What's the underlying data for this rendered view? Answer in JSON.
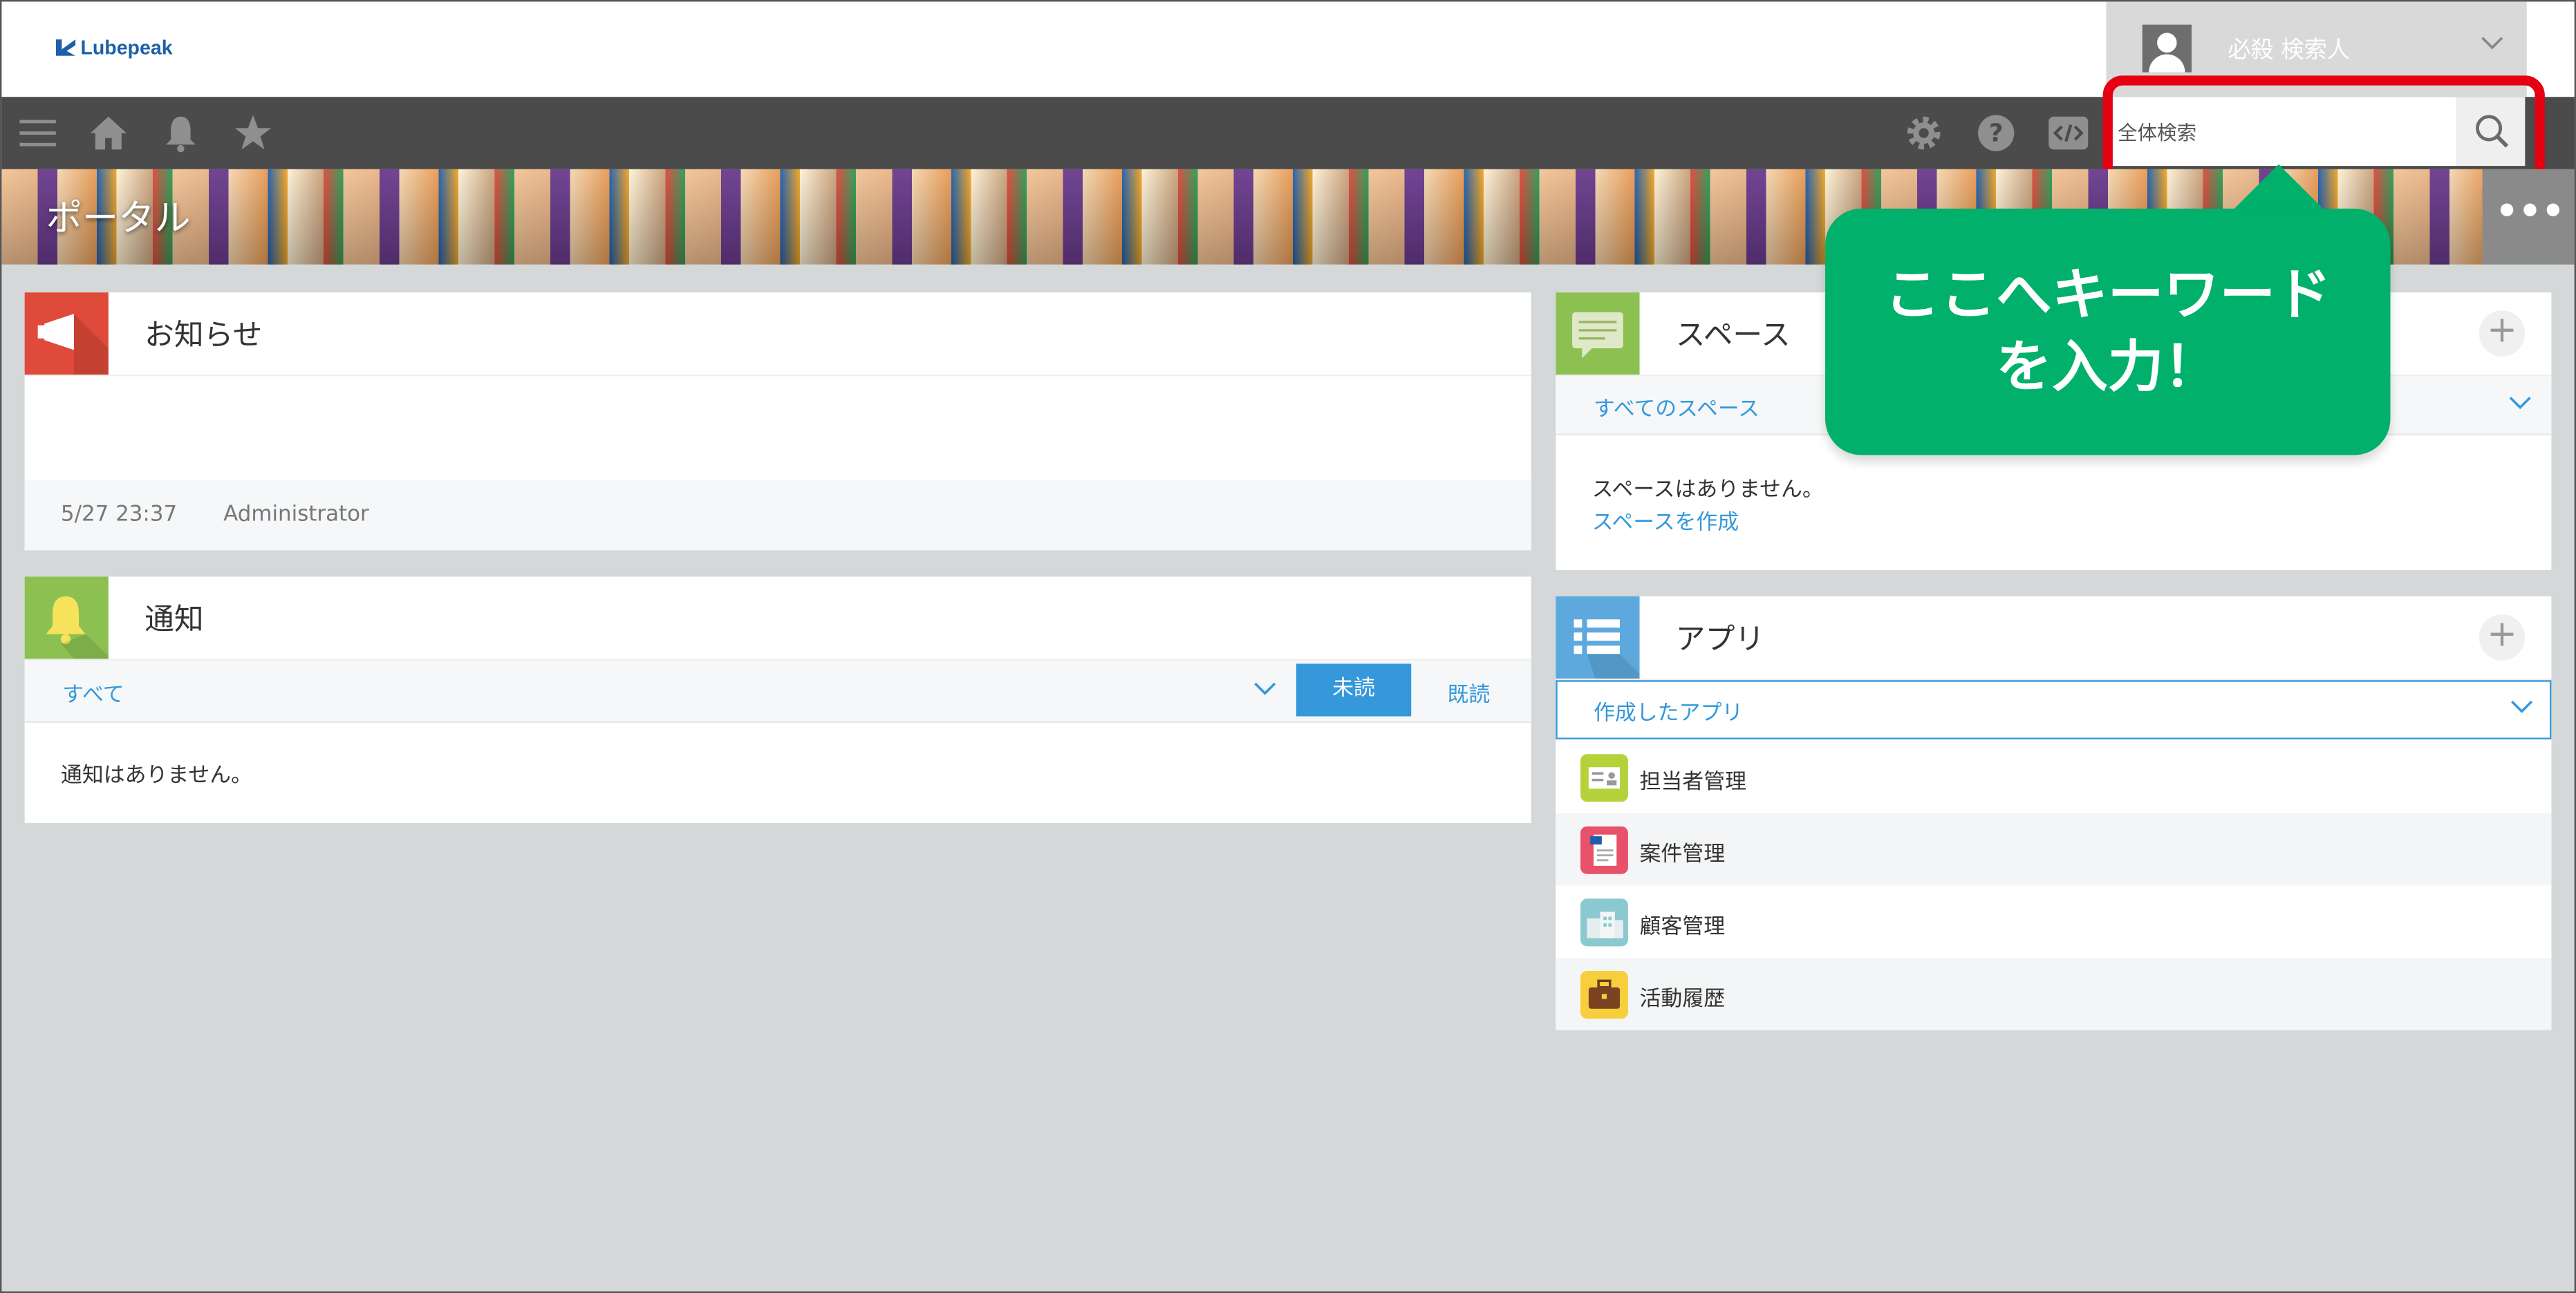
{
  "header": {
    "logo_text": "Lubepeak",
    "user_name": "必殺 検索人"
  },
  "nav": {
    "search_placeholder": "全体検索"
  },
  "banner": {
    "title": "ポータル"
  },
  "notices": {
    "title": "お知らせ",
    "timestamp": "5/27 23:37",
    "author": "Administrator"
  },
  "notifications": {
    "title": "通知",
    "filter": "すべて",
    "tab_unread": "未読",
    "tab_read": "既読",
    "empty": "通知はありません。"
  },
  "spaces": {
    "title": "スペース",
    "filter": "すべてのスペース",
    "empty": "スペースはありません。",
    "create_link": "スペースを作成"
  },
  "apps": {
    "title": "アプリ",
    "filter": "作成したアプリ",
    "items": [
      {
        "label": "担当者管理",
        "icon": "contact-card-icon",
        "color": "#b5d23a"
      },
      {
        "label": "案件管理",
        "icon": "document-icon",
        "color": "#e8516a"
      },
      {
        "label": "顧客管理",
        "icon": "building-icon",
        "color": "#8ac9cf"
      },
      {
        "label": "活動履歴",
        "icon": "briefcase-icon",
        "color": "#f7cf3d"
      }
    ]
  },
  "callout": {
    "line1": "ここへキーワード",
    "line2": "を入力！"
  },
  "colors": {
    "accent": "#3498db",
    "callout": "#00b06b",
    "highlight": "#e60012",
    "nav_bg": "#4b4b4b"
  }
}
